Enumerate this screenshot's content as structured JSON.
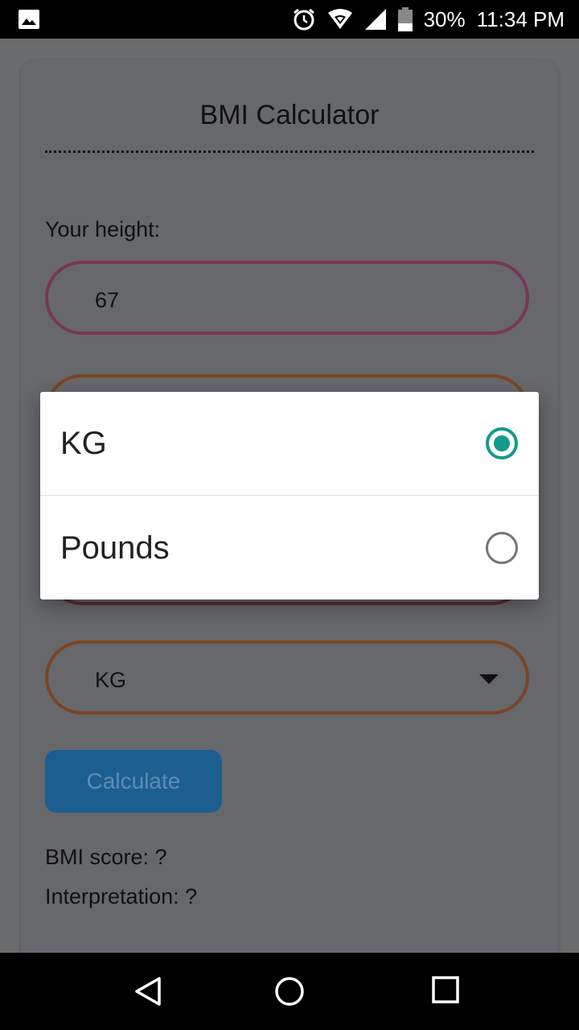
{
  "status_bar": {
    "battery": "30%",
    "time": "11:34 PM",
    "icons": [
      "image-icon",
      "alarm-icon",
      "wifi-icon",
      "signal-icon",
      "battery-icon"
    ]
  },
  "app": {
    "title": "BMI Calculator",
    "height_label": "Your height:",
    "height_value": "67",
    "unit_value": "KG",
    "calculate_label": "Calculate",
    "bmi_score": "BMI score: ?",
    "interpretation": "Interpretation: ?"
  },
  "dialog": {
    "options": [
      {
        "label": "KG",
        "selected": true
      },
      {
        "label": "Pounds",
        "selected": false
      }
    ]
  },
  "colors": {
    "accent": "#139a8a",
    "button": "#1c5e8f"
  },
  "nav_bar": {
    "icons": [
      "back-icon",
      "home-icon",
      "recents-icon"
    ]
  }
}
